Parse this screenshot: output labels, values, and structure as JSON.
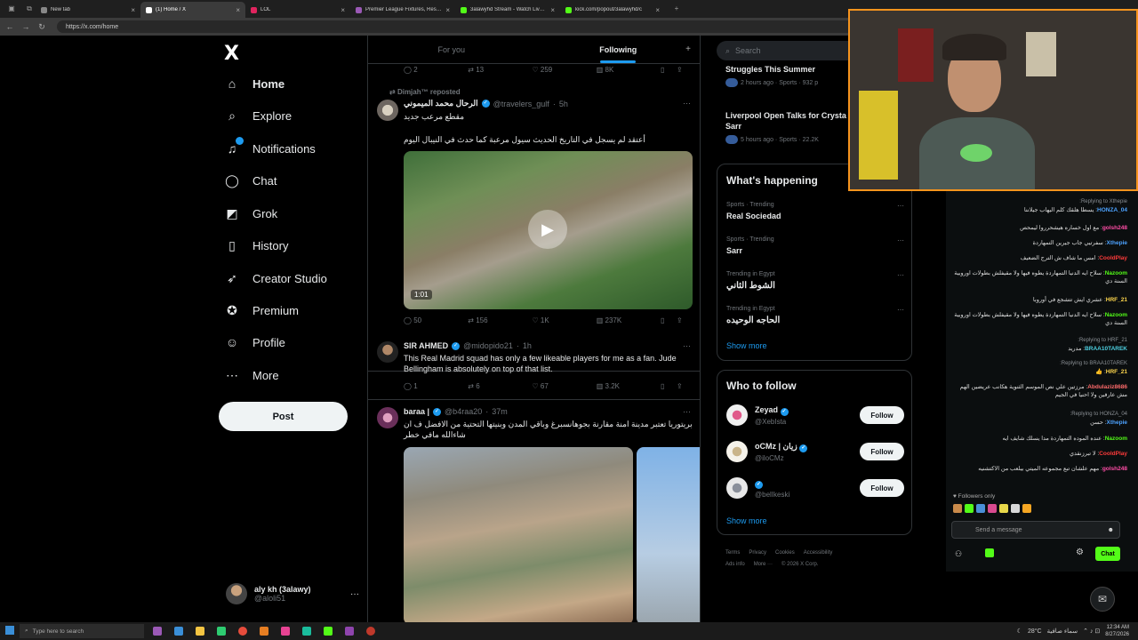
{
  "browser": {
    "tabs": [
      {
        "title": "New tab",
        "color": "#888888"
      },
      {
        "title": "(1) Home / X",
        "color": "#ffffff",
        "active": true
      },
      {
        "title": "LOL",
        "color": "#e0245e"
      },
      {
        "title": "Premier League Fixtures, Results &",
        "color": "#9b59b6"
      },
      {
        "title": "3alawyhd Stream - Watch Live on",
        "color": "#53fc18"
      },
      {
        "title": "kick.com/popout/3alawyhd/c",
        "color": "#53fc18"
      }
    ],
    "url": "https://x.com/home"
  },
  "sidebar": {
    "logo": "X",
    "items": [
      {
        "label": "Home",
        "icon": "home-icon",
        "glyph": "⌂"
      },
      {
        "label": "Explore",
        "icon": "search-icon",
        "glyph": "⌕"
      },
      {
        "label": "Notifications",
        "icon": "bell-icon",
        "glyph": "♫"
      },
      {
        "label": "Chat",
        "icon": "chat-icon",
        "glyph": "◯"
      },
      {
        "label": "Grok",
        "icon": "grok-icon",
        "glyph": "◩"
      },
      {
        "label": "History",
        "icon": "bookmark-icon",
        "glyph": "▯"
      },
      {
        "label": "Creator Studio",
        "icon": "rocket-icon",
        "glyph": "➶"
      },
      {
        "label": "Premium",
        "icon": "premium-icon",
        "glyph": "✪"
      },
      {
        "label": "Profile",
        "icon": "person-icon",
        "glyph": "☺"
      },
      {
        "label": "More",
        "icon": "more-icon",
        "glyph": "⋯"
      }
    ],
    "post_label": "Post",
    "account": {
      "name": "aly kh (3alawy)",
      "handle": "@aloli51"
    }
  },
  "feed": {
    "tabs": [
      "For you",
      "Following"
    ],
    "top_actions": {
      "replies": "2",
      "reposts": "13",
      "likes": "259",
      "views": "8K"
    },
    "tweets": [
      {
        "repost_by": "Dimjah™ reposted",
        "name": "الرحال محمد الميموني",
        "handle": "@travelers_gulf",
        "time": "5h",
        "text1": "مقطع مرعب جديد",
        "text2": "أعتقد لم يسجل في التاريخ الحديث سيول مرعبة كما حدث في النيبال اليوم",
        "video_duration": "1:01",
        "replies": "50",
        "reposts": "156",
        "likes": "1K",
        "views": "237K"
      },
      {
        "name": "SIR AHMED",
        "handle": "@midopido21",
        "time": "1h",
        "text": "This Real Madrid squad has only a few likeable players for me as a fan. Jude Bellingham is absolutely on top of that list.",
        "replies": "1",
        "reposts": "6",
        "likes": "67",
        "views": "3.2K"
      },
      {
        "name": "baraa |",
        "handle": "@b4raa20",
        "time": "37m",
        "text": "بريتوريا تعتبر مدينة امنة مقارنة بجوهانسبرغ وباقي المدن وبنيتها التحتية من الافضل ف ان شاءالله مافي خطر"
      }
    ]
  },
  "right": {
    "search_placeholder": "Search",
    "news": [
      {
        "title": "Struggles This Summer",
        "meta": "2 hours ago · Sports · 932 p"
      },
      {
        "title": "Liverpool Open Talks for Crysta Winger Ismaila Sarr",
        "meta": "5 hours ago · Sports · 22.2K"
      }
    ],
    "whats_happening": "What's happening",
    "trends": [
      {
        "context": "Sports · Trending",
        "name": "Real Sociedad"
      },
      {
        "context": "Sports · Trending",
        "name": "Sarr"
      },
      {
        "context": "Trending in Egypt",
        "name": "الشوط الثاني"
      },
      {
        "context": "Trending in Egypt",
        "name": "الحاجه الوحيده"
      }
    ],
    "show_more": "Show more",
    "who_to_follow": "Who to follow",
    "follow_label": "Follow",
    "suggestions": [
      {
        "name": "Zeyad",
        "handle": "@XebIsta"
      },
      {
        "name": "oCMz | زيان",
        "handle": "@iloCMz"
      },
      {
        "name": "",
        "handle": "@belIkeski"
      }
    ],
    "footer": [
      "Terms",
      "Privacy",
      "Cookies",
      "Accessibility",
      "Ads info",
      "More ···",
      "© 2026 X Corp."
    ]
  },
  "chat": {
    "messages": [
      {
        "reply": "Replying to Xthepie:",
        "user": "HONZA_04",
        "color": "#4da3ff",
        "text": "يسطا هلقك كلم اليهاب جيلاننا"
      },
      {
        "user": "golsh248",
        "color": "#ff4da6",
        "text": "مع اول خساره هيشحرروا ليمحص"
      },
      {
        "user": "Xthepie",
        "color": "#4da3ff",
        "text": "سفرتيي جاب جيرين التمهاردة"
      },
      {
        "user": "CooldPlay",
        "color": "#ff3b3b",
        "text": "امس ما شاف ش الترج الضعيف"
      },
      {
        "user": "Nazoom",
        "color": "#53fc18",
        "text": "سلاح ايه الدنيا التمهاردة يطوه فيها ولا مقيفلش بطولات اوروبية السنة دي"
      },
      {
        "user": "HRF_21",
        "color": "#ffd84d",
        "text": "عشري ايش تتشجع في أوروبا"
      },
      {
        "user": "Nazoom",
        "color": "#53fc18",
        "text": "سلاح ايه الدنيا التمهاردة يطوه فيها ولا مقيفلش بطولات اوروبية السنة دي"
      },
      {
        "reply": "Replying to HRF_21:",
        "user": "BRAA10TAREK",
        "color": "#4dd0e1",
        "text": "مدريد"
      },
      {
        "reply": "Replying to BRAA10TAREK:",
        "user": "HRF_21",
        "color": "#ffd84d",
        "text": "👍"
      },
      {
        "user": "Abdulaziz8686",
        "color": "#ff6b6b",
        "text": "مرزتين علي نص الموسم الثنوية هكانب عريضين الهم مش عارفين ولا احنيا في الجيم"
      },
      {
        "reply": "Replying to HONZA_04:",
        "user": "Xthepie",
        "color": "#4da3ff",
        "text": "حسن"
      },
      {
        "user": "Nazoom",
        "color": "#53fc18",
        "text": "عنده الموده التمهاردة مدا يسلك شايف ايه"
      },
      {
        "user": "CooldPlay",
        "color": "#ff3b3b",
        "text": "لا تبرزنقدي"
      },
      {
        "user": "golsh248",
        "color": "#ff4da6",
        "text": "مهم علشان تبع مجموعه الميتي بيلعب من الاكتشنيه"
      }
    ],
    "followers_only": "♥ Followers only",
    "input_placeholder": "Send a message",
    "chat_button": "Chat"
  },
  "taskbar": {
    "search_placeholder": "Type here to search",
    "weather": "28°C",
    "weather_text": "سماء صافية",
    "time": "12:34 AM",
    "date": "8/27/2026"
  }
}
